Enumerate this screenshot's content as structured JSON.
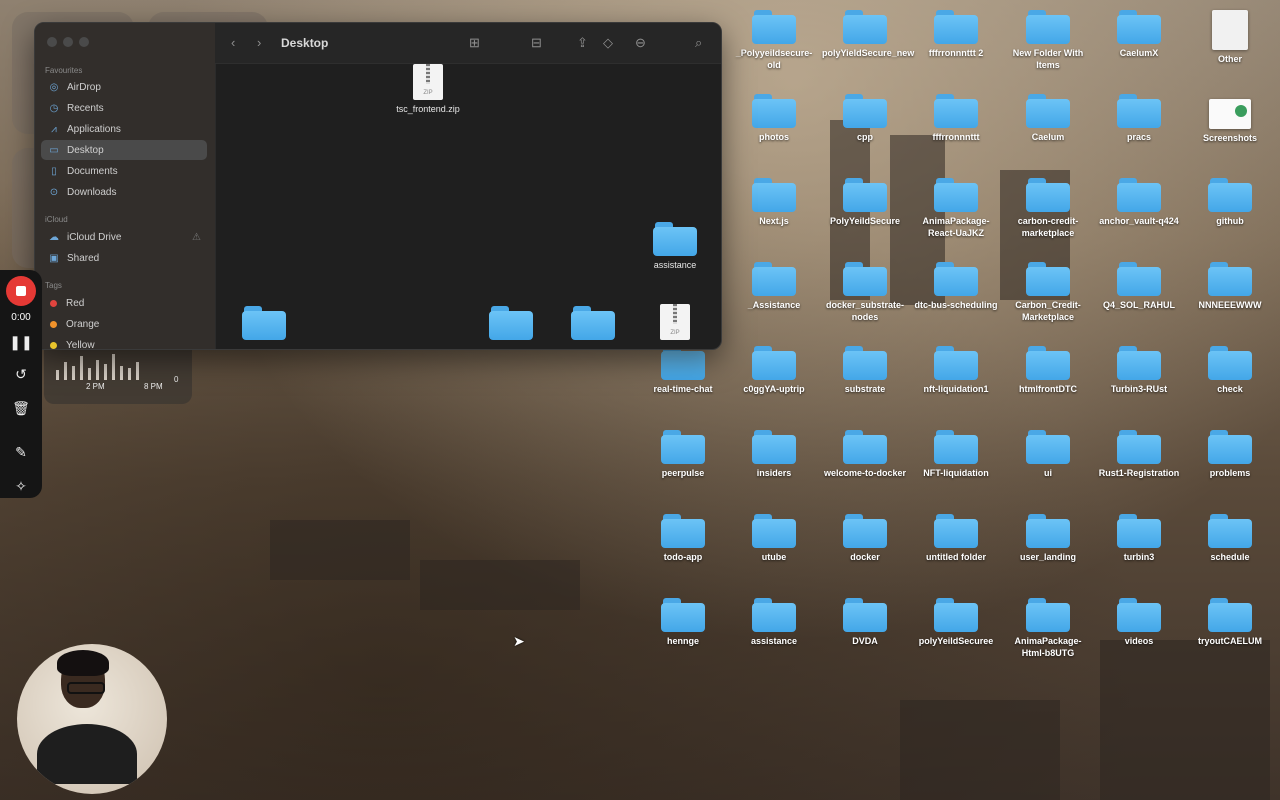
{
  "finder": {
    "title": "Desktop",
    "sidebar": {
      "favourites_label": "Favourites",
      "favourites": [
        {
          "label": "AirDrop",
          "icon": "airdrop-icon"
        },
        {
          "label": "Recents",
          "icon": "clock-icon"
        },
        {
          "label": "Applications",
          "icon": "applications-icon"
        },
        {
          "label": "Desktop",
          "icon": "desktop-icon",
          "selected": true
        },
        {
          "label": "Documents",
          "icon": "document-icon"
        },
        {
          "label": "Downloads",
          "icon": "download-icon"
        }
      ],
      "icloud_label": "iCloud",
      "icloud": [
        {
          "label": "iCloud Drive",
          "icon": "cloud-icon"
        },
        {
          "label": "Shared",
          "icon": "shared-folder-icon"
        }
      ],
      "tags_label": "Tags",
      "tags": [
        {
          "label": "Red",
          "color": "#e0443e"
        },
        {
          "label": "Orange",
          "color": "#f0922b"
        },
        {
          "label": "Yellow",
          "color": "#e8c42c"
        }
      ]
    },
    "items": [
      {
        "label": "tsc_frontend.zip",
        "type": "zip"
      },
      {
        "label": "assistance",
        "type": "folder"
      },
      {
        "label": "",
        "type": "folder"
      },
      {
        "label": "",
        "type": "folder"
      },
      {
        "label": "",
        "type": "folder"
      },
      {
        "label": "",
        "type": "zip"
      }
    ]
  },
  "recorder": {
    "time": "0:00"
  },
  "desktop": {
    "columns": [
      [
        "_Polyyeildsecure-old",
        "photos",
        "Next.js",
        "_Assistance",
        "c0ggYA-uptrip",
        "insiders",
        "utube",
        "assistance"
      ],
      [
        "polyYieldSecure_new",
        "cpp",
        "PolyYeildSecure",
        "docker_substrate-nodes",
        "substrate",
        "welcome-to-docker",
        "docker",
        "DVDA"
      ],
      [
        "fffrronnnttt 2",
        "fffrronnnttt",
        "AnimaPackage-React-UaJKZ",
        "dtc-bus-scheduling",
        "nft-liquidation1",
        "NFT-liquidation",
        "untitled folder",
        "polyYeildSecuree"
      ],
      [
        "New Folder With Items",
        "Caelum",
        "carbon-credit-marketplace",
        "Carbon_Credit-Marketplace",
        "htmlfrontDTC",
        "ui",
        "user_landing",
        "AnimaPackage-Html-b8UTG"
      ],
      [
        "CaelumX",
        "pracs",
        "anchor_vault-q424",
        "Q4_SOL_RAHUL",
        "Turbin3-RUst",
        "Rust1-Registration",
        "turbin3",
        "videos"
      ],
      [
        "Other",
        "Screenshots",
        "github",
        "NNNEEEWWW",
        "check",
        "problems",
        "schedule",
        "tryoutCAELUM"
      ]
    ],
    "extra_column": [
      "real-time-chat",
      "peerpulse",
      "todo-app",
      "hennge"
    ],
    "widget_chart_labels": [
      "2 PM",
      "8 PM",
      "0"
    ]
  },
  "colors": {
    "folder": "#5ab8f2",
    "record": "#e53935"
  }
}
